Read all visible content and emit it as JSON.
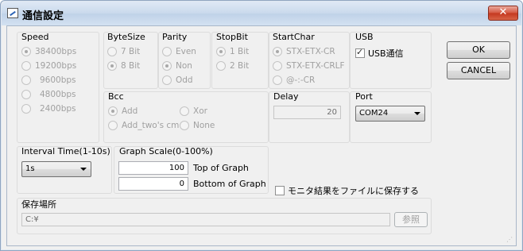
{
  "window": {
    "title": "通信設定",
    "close_label": "✕"
  },
  "speed": {
    "label": "Speed",
    "options": [
      "38400bps",
      "19200bps",
      "9600bps",
      "4800bps",
      "2400bps"
    ],
    "selected": "38400bps"
  },
  "bytesize": {
    "label": "ByteSize",
    "options": [
      "7 Bit",
      "8 Bit"
    ],
    "selected": "8 Bit"
  },
  "parity": {
    "label": "Parity",
    "options": [
      "Even",
      "Non",
      "Odd"
    ],
    "selected": "Non"
  },
  "stopbit": {
    "label": "StopBit",
    "options": [
      "1 Bit",
      "2 Bit"
    ],
    "selected": "1 Bit"
  },
  "startchar": {
    "label": "StartChar",
    "options": [
      "STX-ETX-CR",
      "STX-ETX-CRLF",
      "@-:-CR"
    ],
    "selected": "STX-ETX-CR"
  },
  "usb": {
    "label": "USB",
    "checkbox_label": "USB通信",
    "checked": true
  },
  "bcc": {
    "label": "Bcc",
    "options": [
      "Add",
      "Xor",
      "Add_two's cm",
      "None"
    ],
    "selected": "Add"
  },
  "delay": {
    "label": "Delay",
    "value": "20"
  },
  "port": {
    "label": "Port",
    "value": "COM24"
  },
  "buttons": {
    "ok": "OK",
    "cancel": "CANCEL"
  },
  "interval": {
    "label": "Interval Time(1-10s)",
    "value": "1s"
  },
  "graph": {
    "label": "Graph Scale(0-100%)",
    "top_value": "100",
    "top_label": "Top of Graph",
    "bottom_value": "0",
    "bottom_label": "Bottom of Graph"
  },
  "save_to_file": {
    "label": "モニタ結果をファイルに保存する",
    "checked": false
  },
  "save_location": {
    "label": "保存場所",
    "path": "C:¥",
    "browse_label": "参照"
  }
}
